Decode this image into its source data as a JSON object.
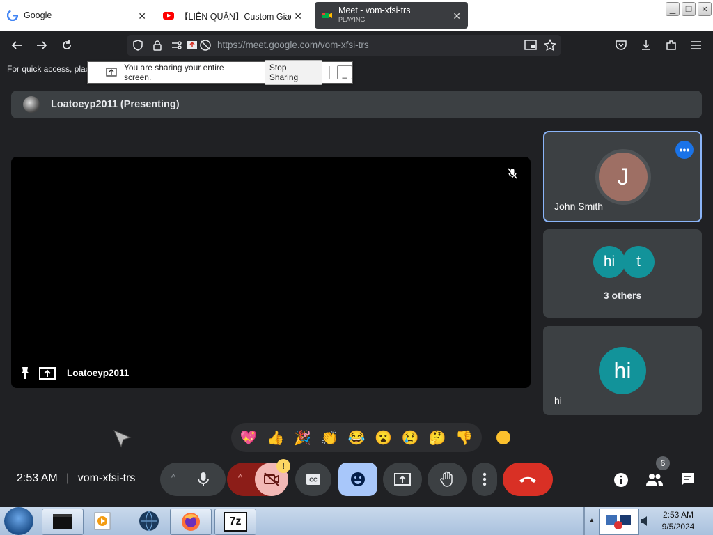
{
  "browser": {
    "tabs": [
      {
        "title": "Google",
        "active": false
      },
      {
        "title": "【LIÊN QUÂN】Custom Giao H",
        "active": false
      },
      {
        "title": "Meet - vom-xfsi-trs",
        "subtitle": "PLAYING",
        "active": true
      }
    ],
    "url": "https://meet.google.com/vom-xfsi-trs",
    "bookmark_hint": "For quick access, plac"
  },
  "share_notice": {
    "message": "You are sharing your entire screen.",
    "stop_label": "Stop Sharing",
    "minimize_label": "_"
  },
  "meet": {
    "presenting_label": "Loatoeyp2011 (Presenting)",
    "main_video_name": "Loatoeyp2011",
    "participants": [
      {
        "initial": "J",
        "name": "John Smith"
      },
      {
        "initials": [
          "hi",
          "t"
        ],
        "label": "3 others"
      },
      {
        "initial": "hi",
        "name": "hi"
      }
    ],
    "reactions": [
      "💖",
      "👍",
      "🎉",
      "👏",
      "😂",
      "😮",
      "😢",
      "🤔",
      "👎"
    ],
    "time": "2:53 AM",
    "meeting_code": "vom-xfsi-trs",
    "people_count": "6",
    "camera_warning": "!"
  },
  "taskbar": {
    "time": "2:53 AM",
    "date": "9/5/2024",
    "apps": [
      "terminal-icon",
      "media-player-icon",
      "globe-icon",
      "firefox-icon",
      "7zip-icon"
    ],
    "sevenzip_label": "7z"
  },
  "colors": {
    "accent_blue": "#8ab4f8",
    "end_call_red": "#d93025",
    "avatar_john": "#9e6f64",
    "avatar_teal": "#12939a"
  }
}
